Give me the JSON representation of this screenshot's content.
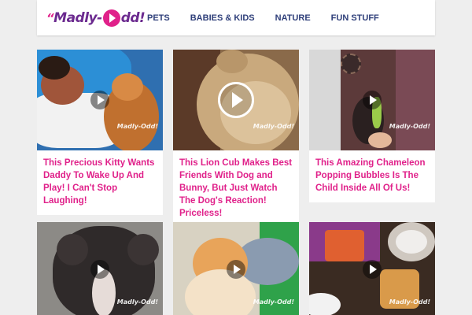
{
  "logo": {
    "text_left": "Madly-",
    "text_right": "dd!",
    "quote": "“"
  },
  "nav": [
    {
      "label": "PETS"
    },
    {
      "label": "BABIES & KIDS"
    },
    {
      "label": "NATURE"
    },
    {
      "label": "FUN STUFF"
    }
  ],
  "watermark": "Madly-Odd!",
  "cards": [
    {
      "title": "This Precious Kitty Wants Daddy To Wake Up And Play! I Can't Stop Laughing!"
    },
    {
      "title": "This Lion Cub Makes Best Friends With Dog and Bunny, But Just Watch The Dog's Reaction! Priceless!"
    },
    {
      "title": "This Amazing Chameleon Popping Bubbles Is The Child Inside All Of Us!"
    }
  ],
  "colors": {
    "accent": "#e0218a",
    "nav": "#2f3f7a",
    "brand": "#6b2a8f"
  }
}
